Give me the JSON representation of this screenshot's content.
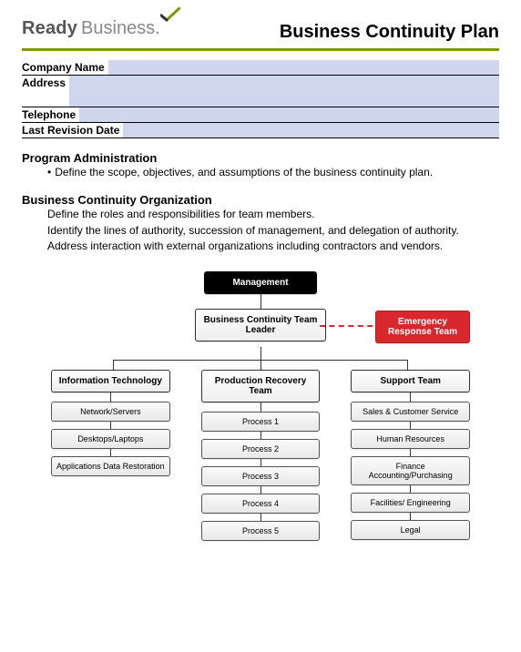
{
  "logo": {
    "ready": "Ready",
    "business": "Business."
  },
  "title": "Business Continuity Plan",
  "form": {
    "company_name_label": "Company Name",
    "address_label": "Address",
    "telephone_label": "Telephone",
    "last_revision_label": "Last Revision Date",
    "company_name": "",
    "address": "",
    "telephone": "",
    "last_revision": ""
  },
  "sections": {
    "admin_heading": "Program Administration",
    "admin_bullet": "Define the scope, objectives, and assumptions of the business continuity plan.",
    "org_heading": "Business Continuity Organization",
    "org_line1": "Define the roles and responsibilities for team members.",
    "org_line2": "Identify the lines of authority, succession of management, and delegation of authority.",
    "org_line3": "Address interaction with external organizations including contractors and vendors."
  },
  "org_chart": {
    "management": "Management",
    "leader": "Business Continuity Team Leader",
    "ert": "Emergency Response Team",
    "col1_head": "Information Technology",
    "col1_items": [
      "Network/Servers",
      "Desktops/Laptops",
      "Applications Data Restoration"
    ],
    "col2_head": "Production Recovery Team",
    "col2_items": [
      "Process 1",
      "Process 2",
      "Process 3",
      "Process 4",
      "Process 5"
    ],
    "col3_head": "Support Team",
    "col3_items": [
      "Sales & Customer Service",
      "Human Resources",
      "Finance Accounting/Purchasing",
      "Facilities/ Engineering",
      "Legal"
    ]
  }
}
